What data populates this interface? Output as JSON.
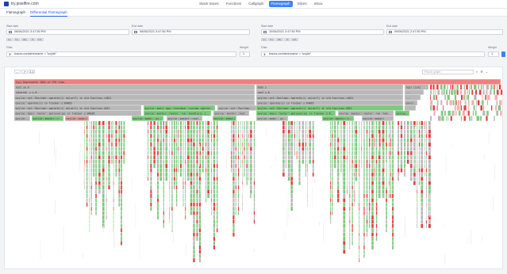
{
  "app": {
    "name": "try.pixelfire.com"
  },
  "nav": [
    {
      "label": "Stack traces",
      "icon": "stack-icon"
    },
    {
      "label": "Functions",
      "icon": "function-icon"
    },
    {
      "label": "Callgraph",
      "icon": "graph-icon"
    },
    {
      "label": "Flamegraph",
      "icon": "flame-icon",
      "active": true
    },
    {
      "label": "Slices",
      "icon": "clock-icon"
    },
    {
      "label": "Inbox",
      "icon": "inbox-icon"
    }
  ],
  "subtabs": [
    {
      "label": "Flamegraph",
      "icon": "flame-icon"
    },
    {
      "label": "Differential Flamegraph",
      "icon": "diff-icon",
      "active": true
    }
  ],
  "left": {
    "start_label": "Start date",
    "start_value": "08/06/2021 3:47:50 PM",
    "end_label": "End date",
    "end_value": "08/06/2021 3:47:50 PM",
    "filter_label": "Filter",
    "filter_value": "traces.containername = \"oxylie\"",
    "weight_label": "Weight",
    "weight_value": "1"
  },
  "right": {
    "start_label": "Start date",
    "start_value": "10/06/2021 2:47:50 PM",
    "end_label": "End date",
    "end_value": "09/06/2021 2:47:50 PM",
    "filter_label": "Filter",
    "filter_value": "traces.containername = \"oxylie\"",
    "weight_label": "Weight",
    "weight_value": "1"
  },
  "quick_ranges": [
    "1m",
    "5m",
    "15m",
    "1h",
    "24h"
  ],
  "graph": {
    "search_placeholder": "Find in graph",
    "controls": [
      "←",
      "↗",
      "1:1"
    ],
    "root_label": "(up) Represents 100% of CPU time.",
    "row_labels": [
      [
        "root.so.6",
        "node.s",
        "(up) [cut]"
      ],
      [
        "(shared) v.s.6",
        "root.s.6",
        "..."
      ],
      [
        "oxylie::ext::Runtime::operate(i) ok(self) in std.function.<4621",
        "oxylie::main() in main.s:8430",
        "..."
      ],
      [
        "oxylie::operate(i) in tracker.s:84065",
        "oxylie::main::app::teardown::custom::execute(i) in app.tracker.s:8825"
      ],
      [
        "oxylie::ext::Runtime::operate(i) ok(self) in std.function.4621",
        "oxylie::main::app::teardown::custom::operate(i) in app.tracker.s:4631"
      ],
      [
        "oxylie::main::router::get(oxylie) in tracker.s:84036",
        "oxylie::master::router::run::handle(i) in handle",
        "oxylie::master::router::operate(i)",
        "oxylie::master::router::run::handle(i) in tracker"
      ],
      [
        "oxylie::make:: oxylie::make() ... ok",
        "oxylie::master::router::run::handle",
        "oxylie::make()"
      ]
    ]
  },
  "colors": {
    "accent": "#3b82f6",
    "root_bar": "#ef8080",
    "gray_bar": "#b8b8b8",
    "green_bar": "#7fc87f",
    "red_bar": "#e14040"
  }
}
